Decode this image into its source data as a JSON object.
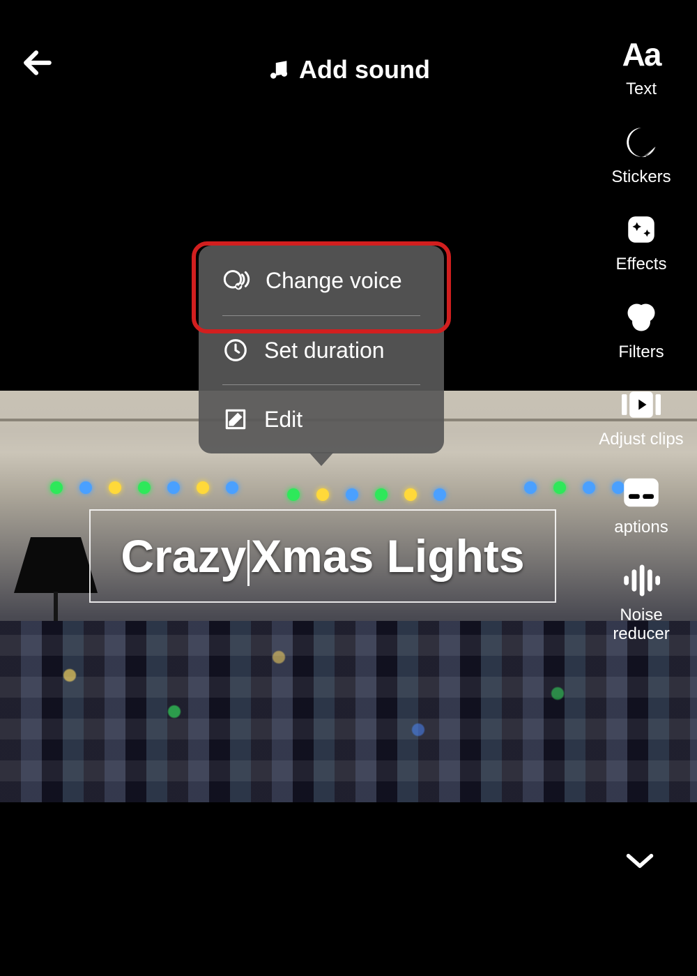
{
  "header": {
    "add_sound_label": "Add sound"
  },
  "tools": {
    "text": "Text",
    "stickers": "Stickers",
    "effects": "Effects",
    "filters": "Filters",
    "adjust_clips": "Adjust clips",
    "captions": "aptions",
    "noise_reducer": "Noise\nreducer"
  },
  "popup": {
    "change_voice": "Change voice",
    "set_duration": "Set duration",
    "edit": "Edit"
  },
  "caption_text_left": "Crazy",
  "caption_text_right": "Xmas Lights"
}
